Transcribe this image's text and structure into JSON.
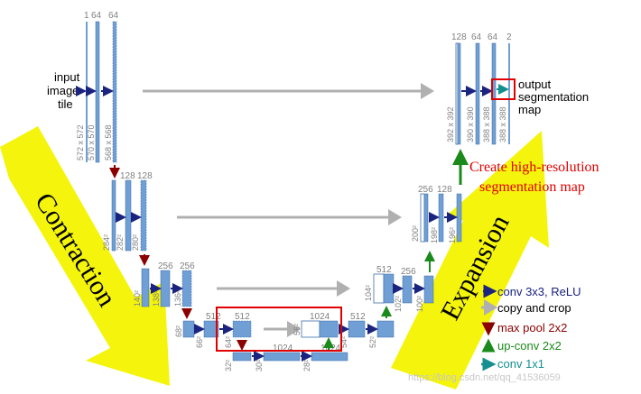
{
  "colors": {
    "map": "#6f9fd4",
    "map_edge": "#3d6ea8",
    "conv_arrow": "#1a237e",
    "copy_arrow": "#b0b0b0",
    "pool_arrow": "#8b0000",
    "upconv_arrow": "#1a8a1a",
    "conv1x1_arrow": "#148f8f",
    "big_arrow": "#f4f40c",
    "highlight": "#e00000"
  },
  "labels": {
    "input": [
      "input",
      "image",
      "tile"
    ],
    "output": [
      "output",
      "segmentation",
      "map"
    ],
    "contraction": "Contraction",
    "expansion": "Expansion",
    "create": [
      "Create high-resolution",
      "segmentation map"
    ],
    "watermark": "https://blog.csdn.net/qq_41536059"
  },
  "channels": {
    "l1": [
      "1",
      "64",
      "64"
    ],
    "l2": [
      "128",
      "128"
    ],
    "l3": [
      "256",
      "256"
    ],
    "l4": [
      "512",
      "512"
    ],
    "l5": [
      "1024",
      "1024"
    ],
    "r4": [
      "1024",
      "512"
    ],
    "r3": [
      "512",
      "256"
    ],
    "r2": [
      "256",
      "128"
    ],
    "r1": [
      "128",
      "64",
      "64",
      "2"
    ]
  },
  "dims": {
    "l1": [
      "572 x 572",
      "570 x 570",
      "568 x 568"
    ],
    "l2": [
      "284²",
      "282²",
      "280²"
    ],
    "l3": [
      "140²",
      "138²",
      "136²"
    ],
    "l4": [
      "68²",
      "66²",
      "64²"
    ],
    "l5": [
      "32²",
      "30²",
      "28²"
    ],
    "r4": [
      "56²",
      "54²",
      "52²"
    ],
    "r3": [
      "104²",
      "102²",
      "100²"
    ],
    "r2": [
      "200²",
      "198²",
      "196²"
    ],
    "r1": [
      "392 x 392",
      "390 x 390",
      "388 x 388",
      "388 x 388"
    ]
  },
  "legend": [
    {
      "label": "conv 3x3, ReLU",
      "icon": "conv-arrow-icon"
    },
    {
      "label": "copy and crop",
      "icon": "copy-arrow-icon"
    },
    {
      "label": "max pool 2x2",
      "icon": "pool-arrow-icon"
    },
    {
      "label": "up-conv 2x2",
      "icon": "upconv-arrow-icon"
    },
    {
      "label": "conv 1x1",
      "icon": "conv1x1-arrow-icon"
    }
  ]
}
